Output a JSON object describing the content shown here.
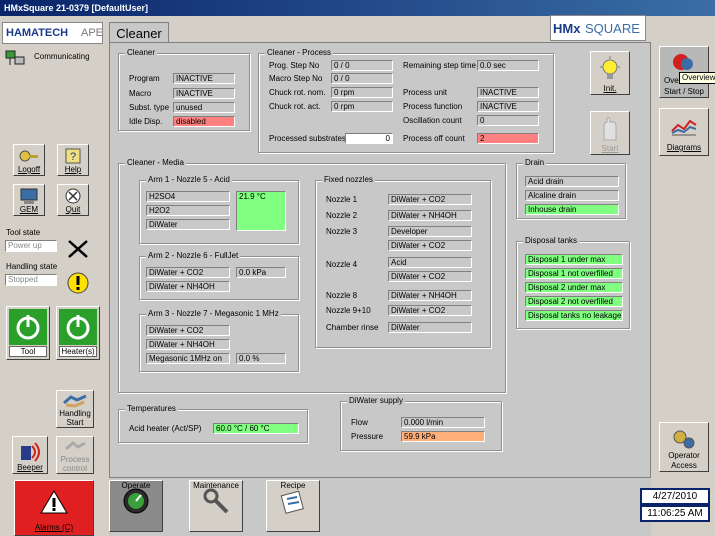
{
  "window": {
    "title": "HMxSquare 21-0379  [DefaultUser]"
  },
  "brand": {
    "left_logo": "HAMATECH",
    "left_logo_suffix": "APE",
    "right_logo_a": "HMx",
    "right_logo_b": "SQUARE"
  },
  "status": {
    "communicating": "Communicating",
    "tool_state_label": "Tool state",
    "tool_state_value": "Power up",
    "handling_state_label": "Handling state",
    "handling_state_value": "Stopped"
  },
  "left_buttons": {
    "logoff": "Logoff",
    "help": "Help",
    "gem": "GEM",
    "quit": "Quit",
    "tool": "Tool",
    "heaters": "Heater(s)",
    "handling_start_1": "Handling",
    "handling_start_2": "Start",
    "beeper": "Beeper",
    "process_control_1": "Process",
    "process_control_2": "control",
    "alarms": "Alarms (C)"
  },
  "tab": {
    "label": "Cleaner"
  },
  "cleaner": {
    "title": "Cleaner",
    "program_label": "Program",
    "program_value": "INACTIVE",
    "macro_label": "Macro",
    "macro_value": "INACTIVE",
    "subst_label": "Subst. type",
    "subst_value": "unused",
    "idle_label": "Idle Disp.",
    "idle_value": "disabled"
  },
  "process": {
    "title": "Cleaner - Process",
    "prog_step_label": "Prog. Step No",
    "prog_step_value": "0 / 0",
    "macro_step_label": "Macro Step No",
    "macro_step_value": "0 / 0",
    "chuck_nom_label": "Chuck rot. nom.",
    "chuck_nom_value": "0 rpm",
    "chuck_act_label": "Chuck rot. act.",
    "chuck_act_value": "0 rpm",
    "remaining_label": "Remaining step time",
    "remaining_value": "0.0 sec",
    "unit_label": "Process unit",
    "unit_value": "INACTIVE",
    "function_label": "Process function",
    "function_value": "INACTIVE",
    "oscillation_label": "Oscillation count",
    "oscillation_value": "0",
    "processed_label": "Processed substrates",
    "processed_value": "0",
    "off_label": "Process off count",
    "off_value": "2"
  },
  "media": {
    "title": "Cleaner - Media",
    "arm1_title": "Arm 1 - Nozzle 5 - Acid",
    "arm1_items": [
      "H2SO4",
      "H2O2",
      "DiWater"
    ],
    "arm1_temp": "21.9 °C",
    "arm2_title": "Arm 2 - Nozzle 6 - FullJet",
    "arm2_items": [
      "DiWater + CO2",
      "DiWater + NH4OH"
    ],
    "arm2_pressure": "0.0 kPa",
    "arm3_title": "Arm 3 - Nozzle 7 - Megasonic 1 MHz",
    "arm3_items": [
      "DiWater + CO2",
      "DiWater + NH4OH"
    ],
    "arm3_mega_label": "Megasonic 1MHz on",
    "arm3_mega_value": "0.0 %",
    "fixed_title": "Fixed nozzles",
    "fixed": {
      "n1_label": "Nozzle 1",
      "n1_value": "DiWater + CO2",
      "n2_label": "Nozzle 2",
      "n2_value": "DiWater + NH4OH",
      "n3_label": "Nozzle 3",
      "n3_value_a": "Developer",
      "n3_value_b": "DiWater + CO2",
      "n4_label": "Nozzle 4",
      "n4_value_a": "Acid",
      "n4_value_b": "DiWater + CO2",
      "n8_label": "Nozzle 8",
      "n8_value": "DiWater + NH4OH",
      "n910_label": "Nozzle 9+10",
      "n910_value": "DiWater + CO2",
      "rinse_label": "Chamber rinse",
      "rinse_value": "DiWater"
    }
  },
  "drain": {
    "title": "Drain",
    "items": [
      "Acid drain",
      "Alcaline drain",
      "Inhouse drain"
    ]
  },
  "disposal": {
    "title": "Disposal tanks",
    "items": [
      "Disposal 1  under max",
      "Disposal 1  not overfilled",
      "Disposal 2  under max",
      "Disposal 2  not overfilled",
      "Disposal tanks no leakage"
    ]
  },
  "temperatures": {
    "title": "Temperatures",
    "heater_label": "Acid heater  (Act/SP)",
    "heater_value": "60.0 °C / 60 °C"
  },
  "diwater": {
    "title": "DiWater supply",
    "flow_label": "Flow",
    "flow_value": "0.000 l/min",
    "pressure_label": "Pressure",
    "pressure_value": "59.9 kPa"
  },
  "main_buttons": {
    "init": "Init.",
    "start": "Start"
  },
  "right_buttons": {
    "overview_1": "Ove",
    "overview_2": "Start / Stop",
    "overview_tooltip": "Overview",
    "diagrams": "Diagrams",
    "operator_1": "Operator",
    "operator_2": "Access"
  },
  "bottom_buttons": {
    "operate": "Operate",
    "maintenance": "Maintenance",
    "recipe": "Recipe"
  },
  "clock": {
    "date": "4/27/2010",
    "time": "11:06:25 AM"
  }
}
